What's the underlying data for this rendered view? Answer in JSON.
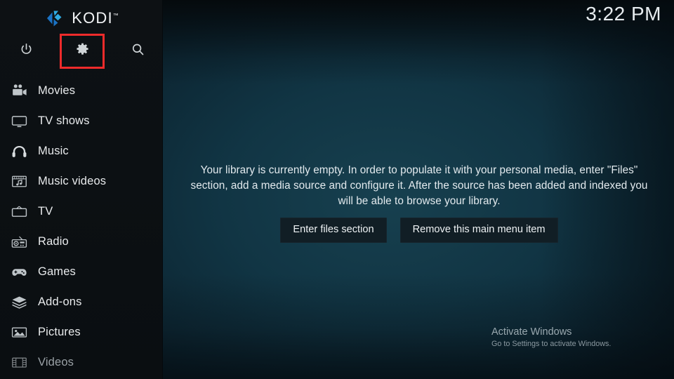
{
  "app": {
    "name": "KODI",
    "trademark": "™",
    "logo_color": "#2eabe2",
    "logo_color_dark": "#1b73c4"
  },
  "clock": {
    "time": "3:22 PM"
  },
  "topbar": {
    "buttons": [
      {
        "name": "power-icon",
        "label": "Power"
      },
      {
        "name": "gear-icon",
        "label": "Settings"
      },
      {
        "name": "search-icon",
        "label": "Search"
      }
    ],
    "highlight": {
      "target": "Settings",
      "color": "#ee2b2b"
    }
  },
  "sidebar": {
    "items": [
      {
        "label": "Movies",
        "icon": "movie-camera-icon",
        "dim": false
      },
      {
        "label": "TV shows",
        "icon": "tv-monitor-icon",
        "dim": false
      },
      {
        "label": "Music",
        "icon": "headphones-icon",
        "dim": false
      },
      {
        "label": "Music videos",
        "icon": "music-video-icon",
        "dim": false
      },
      {
        "label": "TV",
        "icon": "tv-antenna-icon",
        "dim": false
      },
      {
        "label": "Radio",
        "icon": "radio-icon",
        "dim": false
      },
      {
        "label": "Games",
        "icon": "gamepad-icon",
        "dim": false
      },
      {
        "label": "Add-ons",
        "icon": "addons-box-icon",
        "dim": false
      },
      {
        "label": "Pictures",
        "icon": "pictures-icon",
        "dim": false
      },
      {
        "label": "Videos",
        "icon": "film-strip-icon",
        "dim": true
      }
    ]
  },
  "main": {
    "empty_message": "Your library is currently empty. In order to populate it with your personal media, enter \"Files\" section, add a media source and configure it. After the source has been added and indexed you will be able to browse your library.",
    "buttons": {
      "enter_files": "Enter files section",
      "remove_item": "Remove this main menu item"
    }
  },
  "watermark": {
    "title": "Activate Windows",
    "subtitle": "Go to Settings to activate Windows."
  }
}
